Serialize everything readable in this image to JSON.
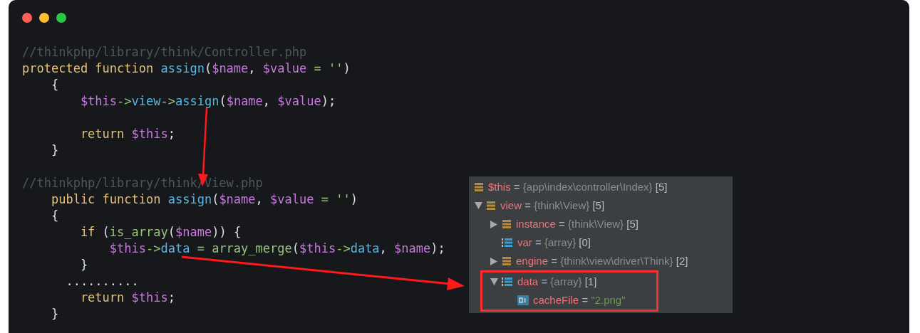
{
  "code_lines": [
    {
      "kind": "code",
      "tokens": [
        {
          "kind": "comment",
          "text": "//thinkphp/library/think/Controller.php"
        }
      ]
    },
    {
      "kind": "code",
      "tokens": [
        {
          "kind": "keyword",
          "text": "protected function "
        },
        {
          "kind": "function",
          "text": "assign"
        },
        {
          "kind": "plain",
          "text": "("
        },
        {
          "kind": "variable",
          "text": "$name"
        },
        {
          "kind": "plain",
          "text": ", "
        },
        {
          "kind": "variable",
          "text": "$value"
        },
        {
          "kind": "operator",
          "text": " = ''"
        },
        {
          "kind": "plain",
          "text": ")"
        }
      ]
    },
    {
      "kind": "code",
      "tokens": [
        {
          "kind": "plain",
          "text": "    {"
        }
      ]
    },
    {
      "kind": "code",
      "tokens": [
        {
          "kind": "variable",
          "text": "        $this"
        },
        {
          "kind": "operator",
          "text": "->"
        },
        {
          "kind": "function",
          "text": "view"
        },
        {
          "kind": "operator",
          "text": "->"
        },
        {
          "kind": "function",
          "text": "assign"
        },
        {
          "kind": "plain",
          "text": "("
        },
        {
          "kind": "variable",
          "text": "$name"
        },
        {
          "kind": "plain",
          "text": ", "
        },
        {
          "kind": "variable",
          "text": "$value"
        },
        {
          "kind": "plain",
          "text": ");"
        }
      ]
    },
    {
      "kind": "blank"
    },
    {
      "kind": "code",
      "tokens": [
        {
          "kind": "keyword",
          "text": "        return "
        },
        {
          "kind": "variable",
          "text": "$this"
        },
        {
          "kind": "plain",
          "text": ";"
        }
      ]
    },
    {
      "kind": "code",
      "tokens": [
        {
          "kind": "plain",
          "text": "    }"
        }
      ]
    },
    {
      "kind": "blank"
    },
    {
      "kind": "code",
      "tokens": [
        {
          "kind": "comment",
          "text": "//thinkphp/library/think/View.php"
        }
      ]
    },
    {
      "kind": "code",
      "tokens": [
        {
          "kind": "keyword",
          "text": "    public function "
        },
        {
          "kind": "function",
          "text": "assign"
        },
        {
          "kind": "plain",
          "text": "("
        },
        {
          "kind": "variable",
          "text": "$name"
        },
        {
          "kind": "plain",
          "text": ", "
        },
        {
          "kind": "variable",
          "text": "$value"
        },
        {
          "kind": "operator",
          "text": " = ''"
        },
        {
          "kind": "plain",
          "text": ")"
        }
      ]
    },
    {
      "kind": "code",
      "tokens": [
        {
          "kind": "plain",
          "text": "    {"
        }
      ]
    },
    {
      "kind": "code",
      "tokens": [
        {
          "kind": "keyword",
          "text": "        if "
        },
        {
          "kind": "plain",
          "text": "("
        },
        {
          "kind": "operator",
          "text": "is_array"
        },
        {
          "kind": "plain",
          "text": "("
        },
        {
          "kind": "variable",
          "text": "$name"
        },
        {
          "kind": "plain",
          "text": ")) {"
        }
      ]
    },
    {
      "kind": "code",
      "tokens": [
        {
          "kind": "variable",
          "text": "            $this"
        },
        {
          "kind": "operator",
          "text": "->"
        },
        {
          "kind": "function",
          "text": "data"
        },
        {
          "kind": "operator",
          "text": " = array_merge"
        },
        {
          "kind": "plain",
          "text": "("
        },
        {
          "kind": "variable",
          "text": "$this"
        },
        {
          "kind": "operator",
          "text": "->"
        },
        {
          "kind": "function",
          "text": "data"
        },
        {
          "kind": "plain",
          "text": ", "
        },
        {
          "kind": "variable",
          "text": "$name"
        },
        {
          "kind": "plain",
          "text": ");"
        }
      ]
    },
    {
      "kind": "code",
      "tokens": [
        {
          "kind": "plain",
          "text": "        }"
        }
      ]
    },
    {
      "kind": "code",
      "tokens": [
        {
          "kind": "plain",
          "text": "      .........."
        }
      ]
    },
    {
      "kind": "code",
      "tokens": [
        {
          "kind": "keyword",
          "text": "        return "
        },
        {
          "kind": "variable",
          "text": "$this"
        },
        {
          "kind": "plain",
          "text": ";"
        }
      ]
    },
    {
      "kind": "code",
      "tokens": [
        {
          "kind": "plain",
          "text": "    }"
        }
      ]
    }
  ],
  "debugger": {
    "variables": [
      {
        "kind": "object",
        "name": "$this",
        "operator": "=",
        "type": "{app\\index\\controller\\Index}",
        "count": "[5]"
      },
      {
        "kind": "object",
        "name": "view",
        "operator": "=",
        "type": "{think\\View}",
        "count": "[5]",
        "expanded": true,
        "children": [
          {
            "kind": "object",
            "name": "instance",
            "operator": "=",
            "type": "{think\\View}",
            "count": "[5]",
            "expanded": false
          },
          {
            "kind": "array",
            "name": "var",
            "operator": "=",
            "type": "{array}",
            "count": "[0]"
          },
          {
            "kind": "object",
            "name": "engine",
            "operator": "=",
            "type": "{think\\view\\driver\\Think}",
            "count": "[2]",
            "expanded": false
          },
          {
            "kind": "array",
            "name": "data",
            "operator": "=",
            "type": "{array}",
            "count": "[1]",
            "expanded": true,
            "highlighted": true,
            "children": [
              {
                "kind": "string",
                "name": "cacheFile",
                "operator": "=",
                "value": "\"2.png\""
              }
            ]
          }
        ]
      }
    ]
  }
}
